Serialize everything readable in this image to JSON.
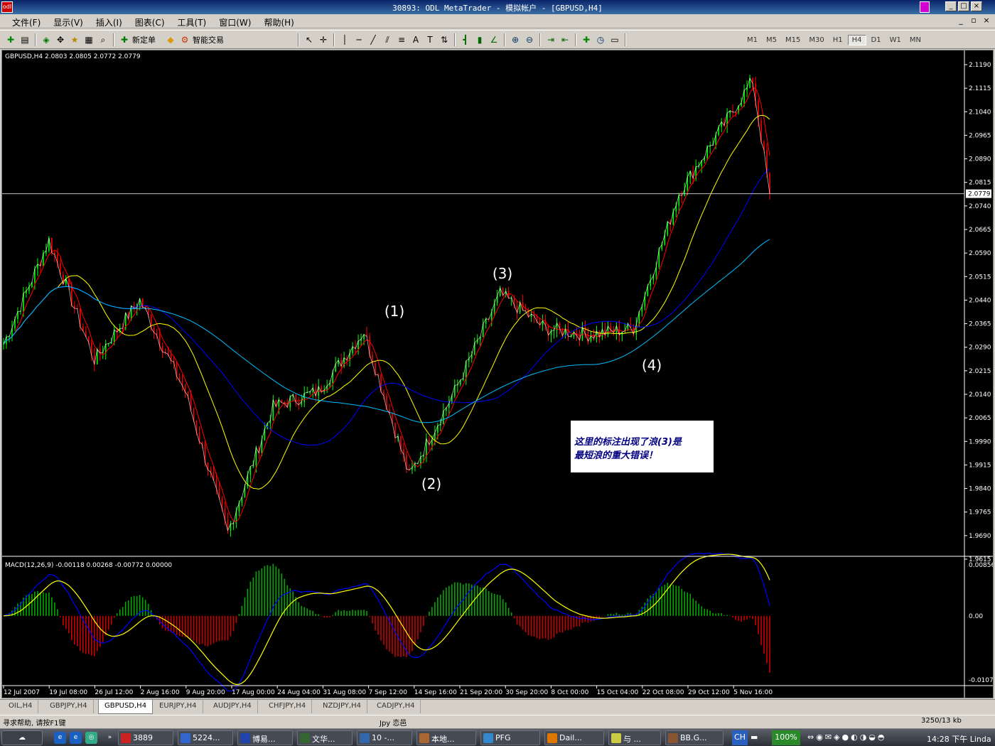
{
  "window": {
    "title": "30893: ODL MetaTrader - 模拟帐户 - [GBPUSD,H4]",
    "min": "_",
    "max": "□",
    "close": "×",
    "mdi_min": "_",
    "mdi_restore": "▫",
    "mdi_close": "×"
  },
  "menu": [
    "文件(F)",
    "显示(V)",
    "插入(I)",
    "图表(C)",
    "工具(T)",
    "窗口(W)",
    "帮助(H)"
  ],
  "toolbar": {
    "new_order": "新定单",
    "expert": "智能交易",
    "timeframes": [
      "M1",
      "M5",
      "M15",
      "M30",
      "H1",
      "H4",
      "D1",
      "W1",
      "MN"
    ],
    "active_timeframe": "H4"
  },
  "chart": {
    "header": "GBPUSD,H4  2.0803 2.0805 2.0772 2.0779",
    "current_price": "2.0779",
    "price_ticks": [
      "2.1190",
      "2.1115",
      "2.1040",
      "2.0965",
      "2.0890",
      "2.0815",
      "2.0740",
      "2.0665",
      "2.0590",
      "2.0515",
      "2.0440",
      "2.0365",
      "2.0290",
      "2.0215",
      "2.0140",
      "2.0065",
      "1.9990",
      "1.9915",
      "1.9840",
      "1.9765",
      "1.9690",
      "1.9615"
    ],
    "wave_labels": [
      "(1)",
      "(2)",
      "(3)",
      "(4)"
    ],
    "annotation": [
      "这里的标注出现了浪(3)是",
      "最短浪的重大错误！"
    ],
    "macd_header": "MACD(12,26,9) -0.00118 0.00268 -0.00772 0.00000",
    "macd_ticks": [
      "0.00856",
      "0.00",
      "-0.01072"
    ],
    "date_ticks": [
      "12 Jul 2007",
      "19 Jul 08:00",
      "26 Jul 12:00",
      "2 Aug 16:00",
      "9 Aug 20:00",
      "17 Aug 00:00",
      "24 Aug 04:00",
      "31 Aug 08:00",
      "7 Sep 12:00",
      "14 Sep 16:00",
      "21 Sep 20:00",
      "30 Sep 20:00",
      "8 Oct 00:00",
      "15 Oct 04:00",
      "22 Oct 08:00",
      "29 Oct 12:00",
      "5 Nov 16:00"
    ],
    "colors": {
      "bull": "#00ff00",
      "bear": "#ff0000",
      "ma_fast": "#ff0000",
      "ma_mid": "#ffff00",
      "ma_slow": "#0000ff",
      "ma_long": "#00bfff",
      "macd_up": "#00aa00",
      "macd_down": "#cc0000",
      "macd_signal": "#ffff00",
      "macd_line": "#0000ff"
    }
  },
  "chart_data": {
    "type": "line",
    "title": "GBPUSD,H4",
    "ylim": [
      1.9615,
      2.119
    ],
    "key_points": [
      {
        "date": "12 Jul 2007",
        "price": 2.03
      },
      {
        "date": "19 Jul 08:00",
        "price": 2.063
      },
      {
        "date": "26 Jul 12:00",
        "price": 2.025
      },
      {
        "date": "2 Aug 16:00",
        "price": 2.044
      },
      {
        "date": "9 Aug 20:00",
        "price": 2.015
      },
      {
        "date": "17 Aug 00:00",
        "price": 1.97
      },
      {
        "date": "24 Aug 04:00",
        "price": 2.01
      },
      {
        "date": "31 Aug 08:00",
        "price": 2.015
      },
      {
        "date": "7 Sep 12:00",
        "price": 2.034
      },
      {
        "date": "14 Sep 16:00",
        "price": 1.988
      },
      {
        "date": "21 Sep 20:00",
        "price": 2.015
      },
      {
        "date": "30 Sep 20:00",
        "price": 2.046
      },
      {
        "date": "8 Oct 00:00",
        "price": 2.035
      },
      {
        "date": "15 Oct 04:00",
        "price": 2.033
      },
      {
        "date": "22 Oct 08:00",
        "price": 2.035
      },
      {
        "date": "29 Oct 12:00",
        "price": 2.078
      },
      {
        "date": "5 Nov 16:00",
        "price": 2.114
      },
      {
        "date": "5 Nov 16:00",
        "price": 2.0779
      }
    ]
  },
  "tabs": [
    "OIL,H4",
    "GBPJPY,H4",
    "GBPUSD,H4",
    "EURJPY,H4",
    "AUDJPY,H4",
    "CHFJPY,H4",
    "NZDJPY,H4",
    "CADJPY,H4"
  ],
  "active_tab": "GBPUSD,H4",
  "status": {
    "help": "寻求帮助, 请按F1键",
    "profile": "Jpy 恋邑",
    "traffic": "3250/13 kb"
  },
  "taskbar": {
    "start": "",
    "tasks": [
      "3889",
      "5224...",
      "博易...",
      "文华...",
      "10 -...",
      "本地...",
      "PFG",
      "Dail...",
      "与 ...",
      "BB.G..."
    ],
    "ime": "CH",
    "zoom": "100%",
    "clock": "14:28 下午 Linda"
  }
}
